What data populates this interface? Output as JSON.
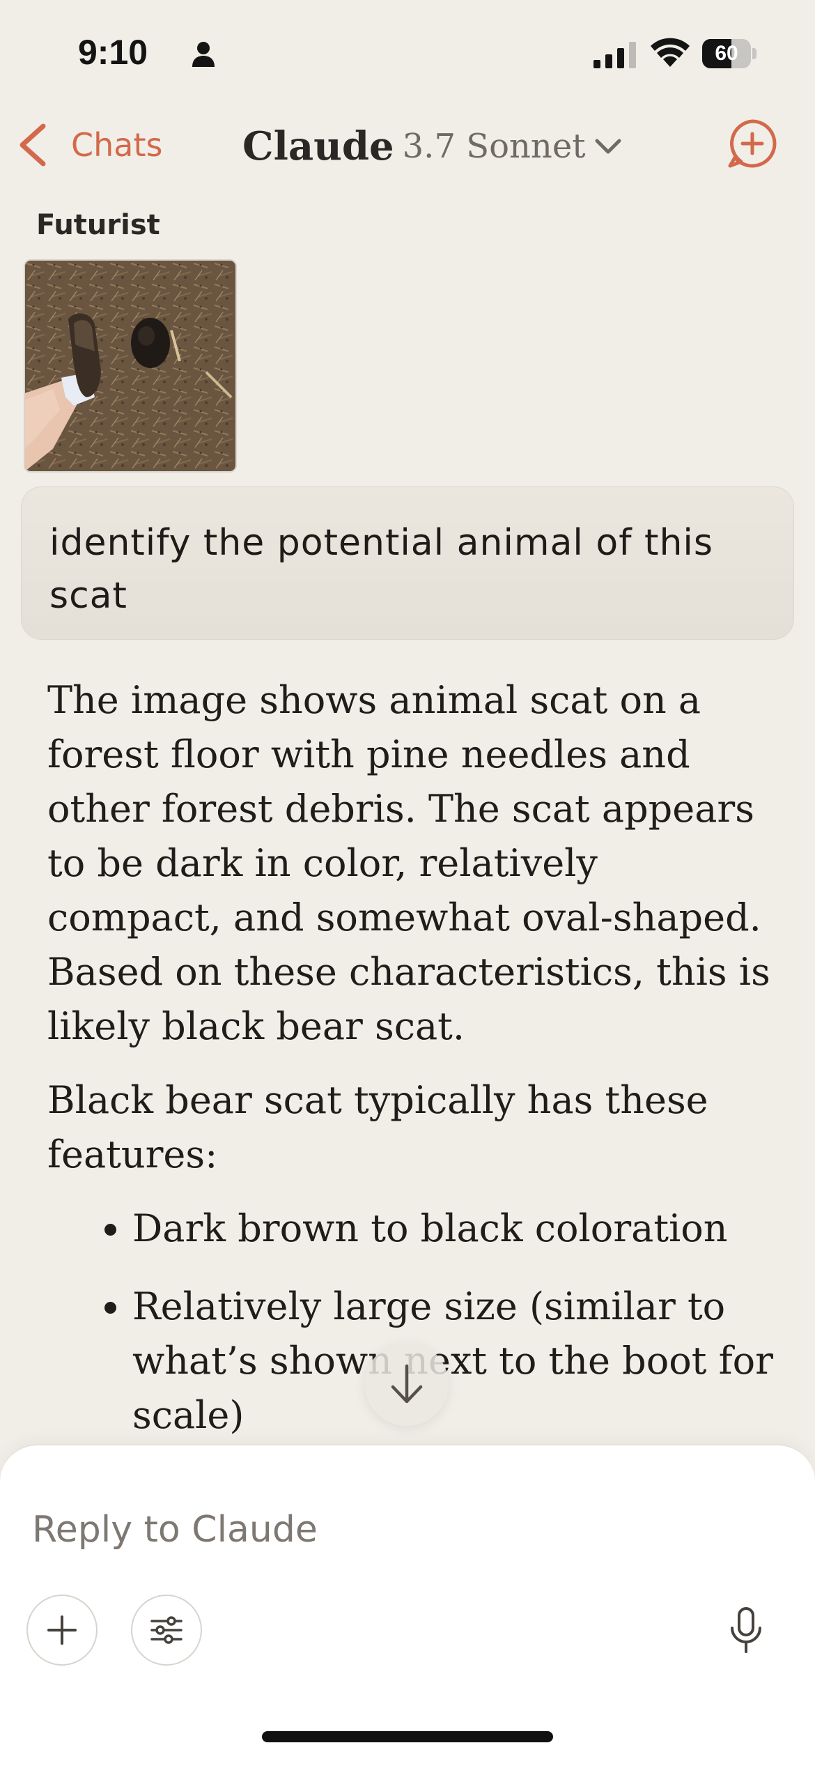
{
  "status_bar": {
    "time": "9:10",
    "battery_level": "60",
    "battery_fraction": 0.6
  },
  "nav": {
    "back_label": "Chats",
    "title": "Claude",
    "model": "3.7 Sonnet"
  },
  "conversation": {
    "sender": "Futurist",
    "user_message": "identify the potential animal of this scat",
    "assistant": {
      "paragraphs": [
        "The image shows animal scat on a forest floor with pine needles and other forest debris. The scat appears to be dark in color, relatively compact, and somewhat oval-shaped. Based on these characteristics, this is likely black bear scat.",
        "Black bear scat typically has these features:"
      ],
      "bullets": [
        "Dark brown to black coloration",
        "Relatively large size (similar to what’s shown next to the boot for scale)"
      ]
    }
  },
  "composer": {
    "placeholder": "Reply to Claude"
  },
  "colors": {
    "accent": "#d3694b",
    "background": "#f1eee8",
    "bubble": "#e8e4dc"
  },
  "icons": {
    "back": "chevron-left-icon",
    "model_dropdown": "chevron-down-icon",
    "new_chat": "new-chat-icon",
    "scroll_down": "arrow-down-icon",
    "add": "plus-icon",
    "tools": "sliders-icon",
    "mic": "microphone-icon"
  }
}
